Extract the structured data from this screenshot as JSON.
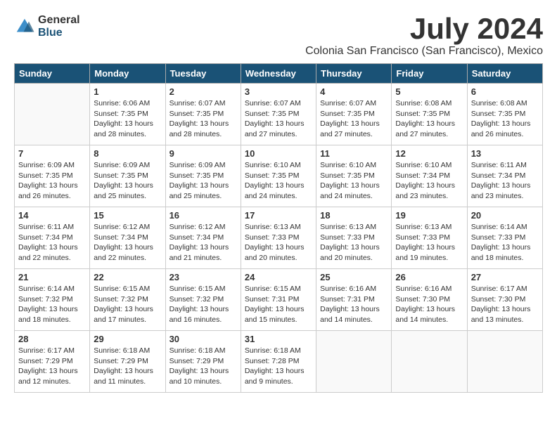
{
  "logo": {
    "general": "General",
    "blue": "Blue"
  },
  "header": {
    "month": "July 2024",
    "location": "Colonia San Francisco (San Francisco), Mexico"
  },
  "days_of_week": [
    "Sunday",
    "Monday",
    "Tuesday",
    "Wednesday",
    "Thursday",
    "Friday",
    "Saturday"
  ],
  "weeks": [
    [
      {
        "day": "",
        "info": ""
      },
      {
        "day": "1",
        "info": "Sunrise: 6:06 AM\nSunset: 7:35 PM\nDaylight: 13 hours\nand 28 minutes."
      },
      {
        "day": "2",
        "info": "Sunrise: 6:07 AM\nSunset: 7:35 PM\nDaylight: 13 hours\nand 28 minutes."
      },
      {
        "day": "3",
        "info": "Sunrise: 6:07 AM\nSunset: 7:35 PM\nDaylight: 13 hours\nand 27 minutes."
      },
      {
        "day": "4",
        "info": "Sunrise: 6:07 AM\nSunset: 7:35 PM\nDaylight: 13 hours\nand 27 minutes."
      },
      {
        "day": "5",
        "info": "Sunrise: 6:08 AM\nSunset: 7:35 PM\nDaylight: 13 hours\nand 27 minutes."
      },
      {
        "day": "6",
        "info": "Sunrise: 6:08 AM\nSunset: 7:35 PM\nDaylight: 13 hours\nand 26 minutes."
      }
    ],
    [
      {
        "day": "7",
        "info": "Sunrise: 6:09 AM\nSunset: 7:35 PM\nDaylight: 13 hours\nand 26 minutes."
      },
      {
        "day": "8",
        "info": "Sunrise: 6:09 AM\nSunset: 7:35 PM\nDaylight: 13 hours\nand 25 minutes."
      },
      {
        "day": "9",
        "info": "Sunrise: 6:09 AM\nSunset: 7:35 PM\nDaylight: 13 hours\nand 25 minutes."
      },
      {
        "day": "10",
        "info": "Sunrise: 6:10 AM\nSunset: 7:35 PM\nDaylight: 13 hours\nand 24 minutes."
      },
      {
        "day": "11",
        "info": "Sunrise: 6:10 AM\nSunset: 7:35 PM\nDaylight: 13 hours\nand 24 minutes."
      },
      {
        "day": "12",
        "info": "Sunrise: 6:10 AM\nSunset: 7:34 PM\nDaylight: 13 hours\nand 23 minutes."
      },
      {
        "day": "13",
        "info": "Sunrise: 6:11 AM\nSunset: 7:34 PM\nDaylight: 13 hours\nand 23 minutes."
      }
    ],
    [
      {
        "day": "14",
        "info": "Sunrise: 6:11 AM\nSunset: 7:34 PM\nDaylight: 13 hours\nand 22 minutes."
      },
      {
        "day": "15",
        "info": "Sunrise: 6:12 AM\nSunset: 7:34 PM\nDaylight: 13 hours\nand 22 minutes."
      },
      {
        "day": "16",
        "info": "Sunrise: 6:12 AM\nSunset: 7:34 PM\nDaylight: 13 hours\nand 21 minutes."
      },
      {
        "day": "17",
        "info": "Sunrise: 6:13 AM\nSunset: 7:33 PM\nDaylight: 13 hours\nand 20 minutes."
      },
      {
        "day": "18",
        "info": "Sunrise: 6:13 AM\nSunset: 7:33 PM\nDaylight: 13 hours\nand 20 minutes."
      },
      {
        "day": "19",
        "info": "Sunrise: 6:13 AM\nSunset: 7:33 PM\nDaylight: 13 hours\nand 19 minutes."
      },
      {
        "day": "20",
        "info": "Sunrise: 6:14 AM\nSunset: 7:33 PM\nDaylight: 13 hours\nand 18 minutes."
      }
    ],
    [
      {
        "day": "21",
        "info": "Sunrise: 6:14 AM\nSunset: 7:32 PM\nDaylight: 13 hours\nand 18 minutes."
      },
      {
        "day": "22",
        "info": "Sunrise: 6:15 AM\nSunset: 7:32 PM\nDaylight: 13 hours\nand 17 minutes."
      },
      {
        "day": "23",
        "info": "Sunrise: 6:15 AM\nSunset: 7:32 PM\nDaylight: 13 hours\nand 16 minutes."
      },
      {
        "day": "24",
        "info": "Sunrise: 6:15 AM\nSunset: 7:31 PM\nDaylight: 13 hours\nand 15 minutes."
      },
      {
        "day": "25",
        "info": "Sunrise: 6:16 AM\nSunset: 7:31 PM\nDaylight: 13 hours\nand 14 minutes."
      },
      {
        "day": "26",
        "info": "Sunrise: 6:16 AM\nSunset: 7:30 PM\nDaylight: 13 hours\nand 14 minutes."
      },
      {
        "day": "27",
        "info": "Sunrise: 6:17 AM\nSunset: 7:30 PM\nDaylight: 13 hours\nand 13 minutes."
      }
    ],
    [
      {
        "day": "28",
        "info": "Sunrise: 6:17 AM\nSunset: 7:29 PM\nDaylight: 13 hours\nand 12 minutes."
      },
      {
        "day": "29",
        "info": "Sunrise: 6:18 AM\nSunset: 7:29 PM\nDaylight: 13 hours\nand 11 minutes."
      },
      {
        "day": "30",
        "info": "Sunrise: 6:18 AM\nSunset: 7:29 PM\nDaylight: 13 hours\nand 10 minutes."
      },
      {
        "day": "31",
        "info": "Sunrise: 6:18 AM\nSunset: 7:28 PM\nDaylight: 13 hours\nand 9 minutes."
      },
      {
        "day": "",
        "info": ""
      },
      {
        "day": "",
        "info": ""
      },
      {
        "day": "",
        "info": ""
      }
    ]
  ]
}
